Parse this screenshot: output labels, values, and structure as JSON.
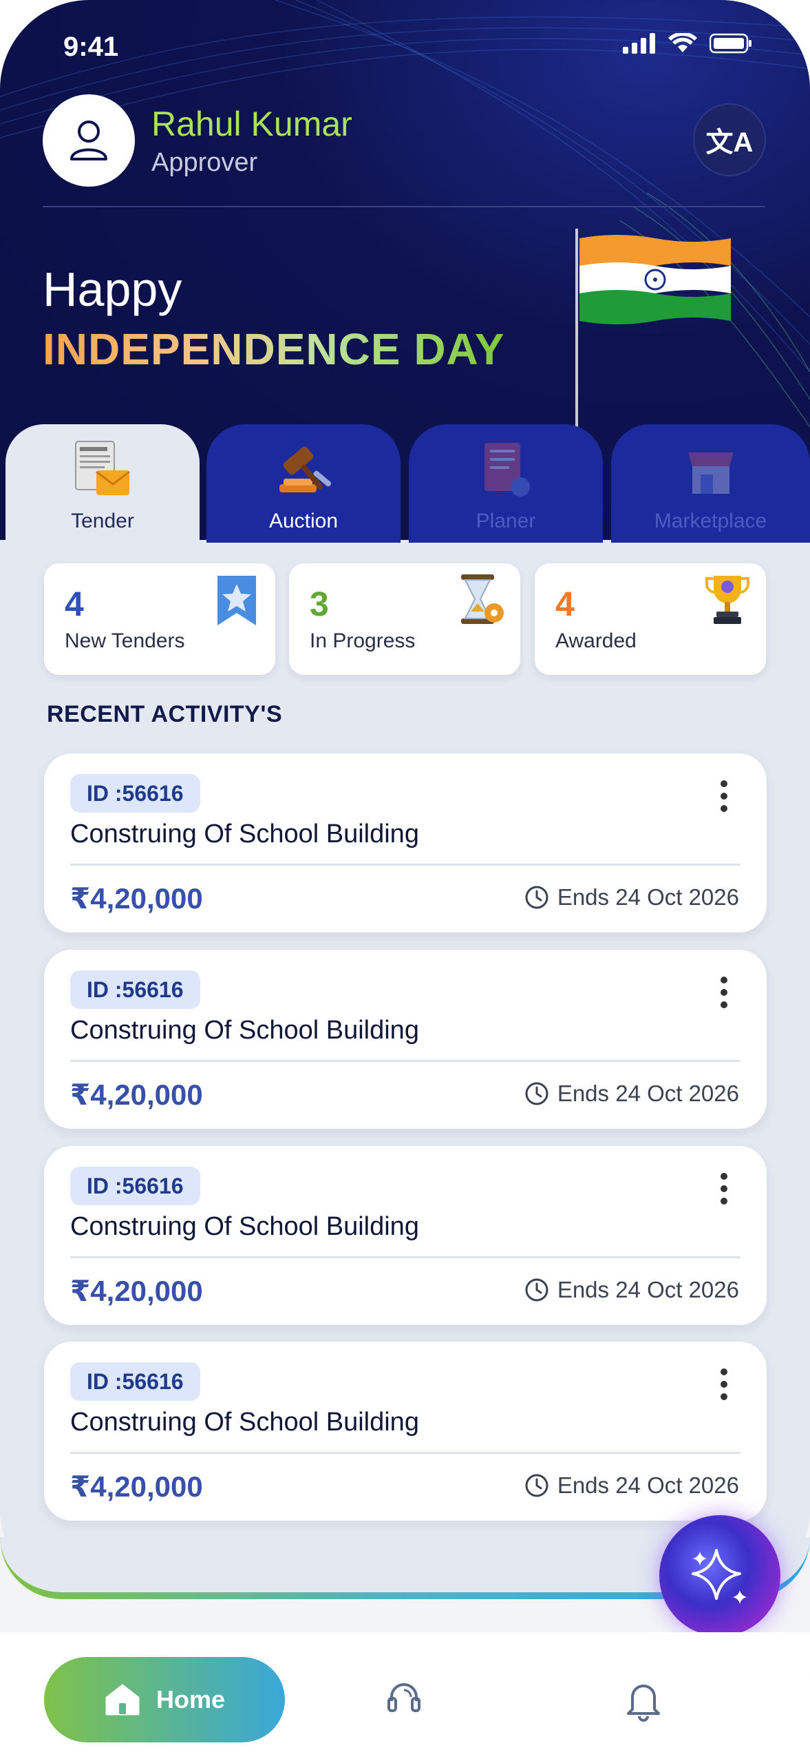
{
  "status_bar": {
    "time": "9:41",
    "icons": [
      "signal-icon",
      "wifi-icon",
      "battery-icon"
    ]
  },
  "profile": {
    "name": "Rahul Kumar",
    "role": "Approver"
  },
  "translate_button": {
    "icon": "translate-icon",
    "label": "文A"
  },
  "banner": {
    "line1": "Happy",
    "line2": "INDEPENDENCE DAY"
  },
  "tabs": [
    {
      "label": "Tender",
      "state": "active",
      "icon": "tender-icon"
    },
    {
      "label": "Auction",
      "state": "inactive",
      "icon": "auction-gavel-icon"
    },
    {
      "label": "Planer",
      "state": "disabled",
      "icon": "planer-icon"
    },
    {
      "label": "Marketplace",
      "state": "disabled",
      "icon": "marketplace-icon"
    }
  ],
  "stats": [
    {
      "count": "4",
      "label": "New Tenders",
      "color": "#2f4fbf",
      "icon": "star-bookmark-icon"
    },
    {
      "count": "3",
      "label": "In Progress",
      "color": "#62a832",
      "icon": "hourglass-gear-icon"
    },
    {
      "count": "4",
      "label": "Awarded",
      "color": "#f07a2a",
      "icon": "trophy-icon"
    }
  ],
  "recent": {
    "title": "RECENT ACTIVITY'S",
    "items": [
      {
        "id": "ID :56616",
        "title": "Construing Of School Building",
        "amount": "₹4,20,000",
        "ends": "Ends 24 Oct 2026"
      },
      {
        "id": "ID :56616",
        "title": "Construing Of School Building",
        "amount": "₹4,20,000",
        "ends": "Ends 24 Oct 2026"
      },
      {
        "id": "ID :56616",
        "title": "Construing Of School Building",
        "amount": "₹4,20,000",
        "ends": "Ends 24 Oct 2026"
      },
      {
        "id": "ID :56616",
        "title": "Construing Of School Building",
        "amount": "₹4,20,000",
        "ends": "Ends 24 Oct 2026"
      }
    ]
  },
  "fab": {
    "icon": "sparkle-ai-icon"
  },
  "bottom_nav": {
    "home_label": "Home",
    "items": [
      "home-icon",
      "support-headset-icon",
      "bell-icon"
    ]
  }
}
